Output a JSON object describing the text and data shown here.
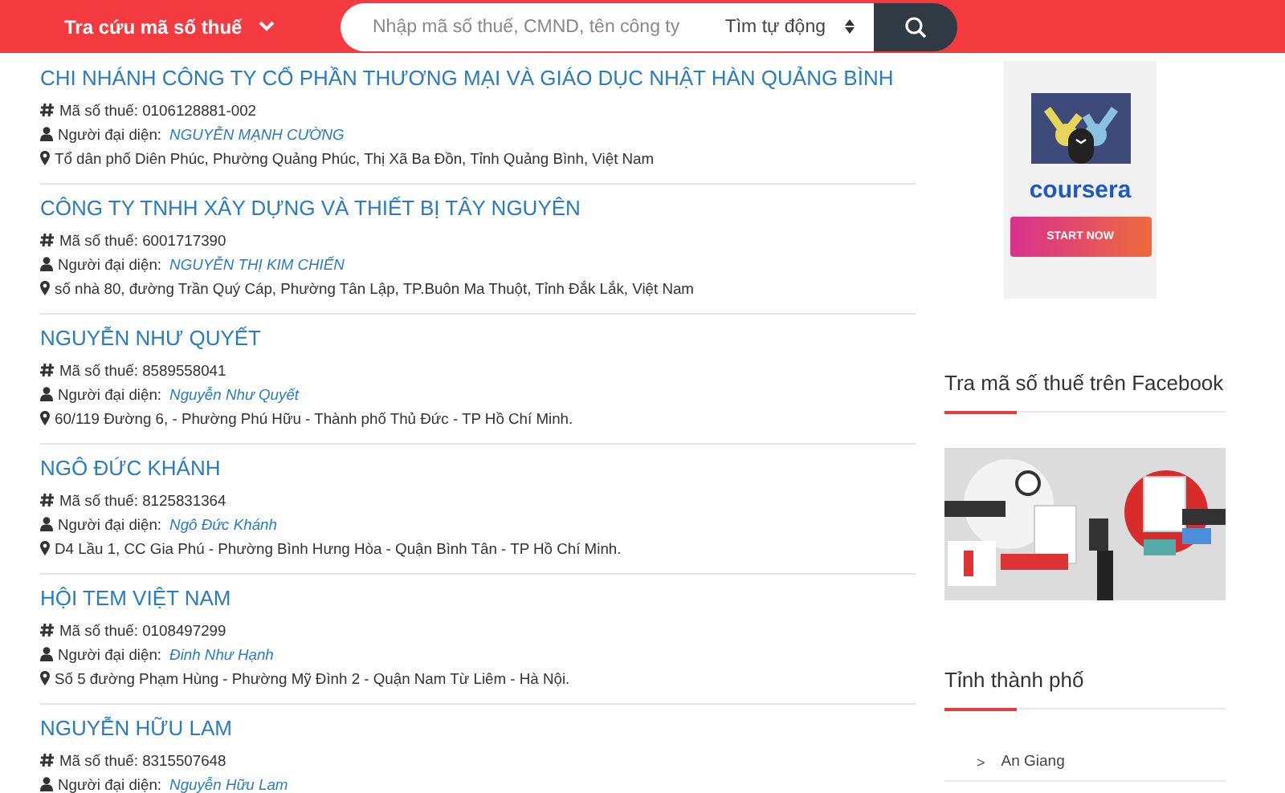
{
  "header": {
    "menu_label": "Tra cứu mã số thuế",
    "search": {
      "placeholder": "Nhập mã số thuế, CMND, tên công ty"
    },
    "mode_select": "Tìm tự động"
  },
  "companies": [
    {
      "name": "CHI NHÁNH CÔNG TY CỔ PHẦN THƯƠNG MẠI VÀ GIÁO DỤC NHẬT HÀN QUẢNG BÌNH",
      "tax_label": "Mã số thuế:",
      "tax_code": "0106128881-002",
      "rep_label": "Người đại diện:",
      "representative": "NGUYỄN MẠNH CƯỜNG",
      "address": "Tổ dân phố Diên Phúc, Phường Quảng Phúc, Thị Xã Ba Đồn, Tỉnh Quảng Bình, Việt Nam"
    },
    {
      "name": "CÔNG TY TNHH XÂY DỰNG VÀ THIẾT BỊ TÂY NGUYÊN",
      "tax_label": "Mã số thuế:",
      "tax_code": "6001717390",
      "rep_label": "Người đại diện:",
      "representative": "NGUYỄN THỊ KIM CHIẾN",
      "address": "số nhà 80, đường Trần Quý Cáp, Phường Tân Lập, TP.Buôn Ma Thuột, Tỉnh Đắk Lắk, Việt Nam"
    },
    {
      "name": "NGUYỄN NHƯ QUYẾT",
      "tax_label": "Mã số thuế:",
      "tax_code": "8589558041",
      "rep_label": "Người đại diện:",
      "representative": "Nguyễn Như Quyết",
      "address": "60/119 Đường 6, - Phường Phú Hữu - Thành phố Thủ Đức - TP Hồ Chí Minh."
    },
    {
      "name": "NGÔ ĐỨC KHÁNH",
      "tax_label": "Mã số thuế:",
      "tax_code": "8125831364",
      "rep_label": "Người đại diện:",
      "representative": "Ngô Đức Khánh",
      "address": "D4 Lầu 1, CC Gia Phú - Phường Bình Hưng Hòa - Quận Bình Tân - TP Hồ Chí Minh."
    },
    {
      "name": "HỘI TEM VIỆT NAM",
      "tax_label": "Mã số thuế:",
      "tax_code": "0108497299",
      "rep_label": "Người đại diện:",
      "representative": "Đinh Như Hạnh",
      "address": "Số 5 đường Phạm Hùng - Phường Mỹ Đình 2 - Quận Nam Từ Liêm - Hà Nội."
    },
    {
      "name": "NGUYỄN HỮU LAM",
      "tax_label": "Mã số thuế:",
      "tax_code": "8315507648",
      "rep_label": "Người đại diện:",
      "representative": "Nguyễn Hữu Lam"
    }
  ],
  "sidebar": {
    "ad": {
      "brand": "coursera",
      "button": "START NOW"
    },
    "facebook_heading": "Tra mã số thuế trên Facebook",
    "provinces_heading": "Tỉnh thành phố",
    "provinces": [
      {
        "marker": ">",
        "name": "An Giang"
      }
    ]
  }
}
